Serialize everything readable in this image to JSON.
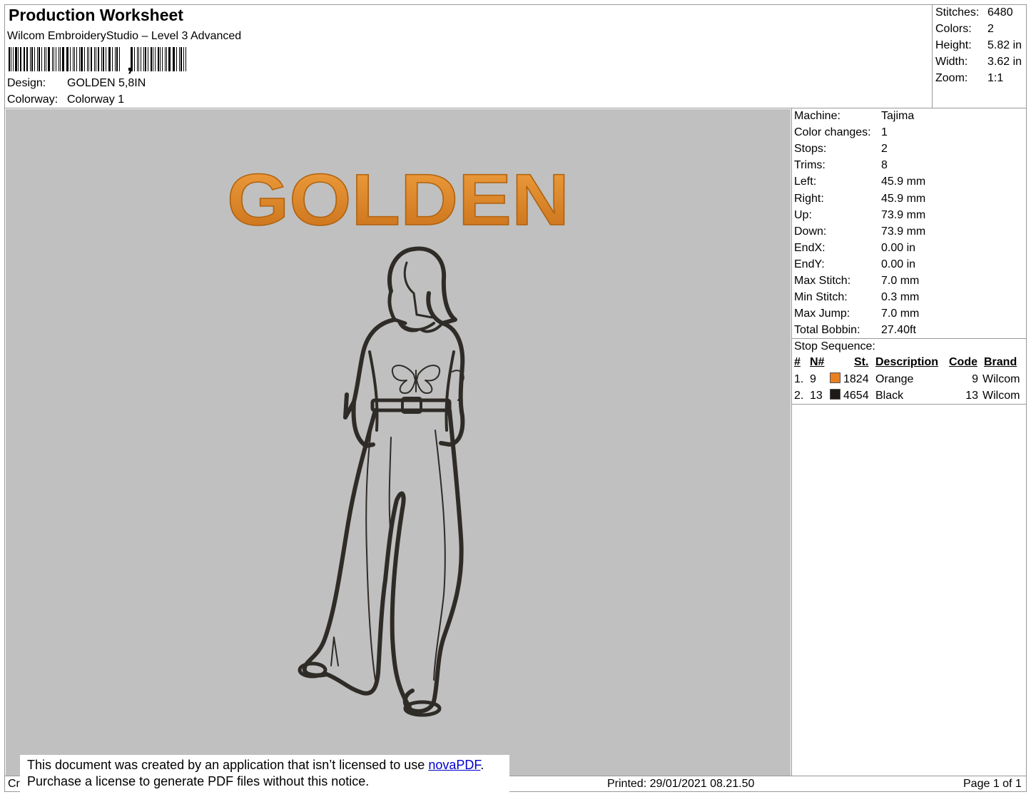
{
  "header": {
    "title": "Production Worksheet",
    "software": "Wilcom EmbroideryStudio – Level 3 Advanced",
    "barcode_char": ",",
    "design_label": "Design:",
    "design_value": "GOLDEN 5,8IN",
    "colorway_label": "Colorway:",
    "colorway_value": "Colorway 1"
  },
  "summary": [
    {
      "label": "Stitches:",
      "value": "6480"
    },
    {
      "label": "Colors:",
      "value": "2"
    },
    {
      "label": "Height:",
      "value": "5.82 in"
    },
    {
      "label": "Width:",
      "value": "3.62 in"
    },
    {
      "label": "Zoom:",
      "value": "1:1"
    }
  ],
  "machine_info": [
    {
      "label": "Machine:",
      "value": "Tajima"
    },
    {
      "label": "Color changes:",
      "value": "1"
    },
    {
      "label": "Stops:",
      "value": "2"
    },
    {
      "label": "Trims:",
      "value": "8"
    },
    {
      "label": "Left:",
      "value": "45.9 mm"
    },
    {
      "label": "Right:",
      "value": "45.9 mm"
    },
    {
      "label": "Up:",
      "value": "73.9 mm"
    },
    {
      "label": "Down:",
      "value": "73.9 mm"
    },
    {
      "label": "EndX:",
      "value": "0.00 in"
    },
    {
      "label": "EndY:",
      "value": "0.00 in"
    },
    {
      "label": "Max Stitch:",
      "value": "7.0 mm"
    },
    {
      "label": "Min Stitch:",
      "value": "0.3 mm"
    },
    {
      "label": "Max Jump:",
      "value": "7.0 mm"
    },
    {
      "label": "Total Bobbin:",
      "value": "27.40ft"
    }
  ],
  "stop_sequence": {
    "title": "Stop Sequence:",
    "headers": {
      "num": "#",
      "n": "N#",
      "st": "St.",
      "desc": "Description",
      "code": "Code",
      "brand": "Brand"
    },
    "rows": [
      {
        "num": "1.",
        "n": "9",
        "color": "#e8801f",
        "st": "1824",
        "desc": "Orange",
        "code": "9",
        "brand": "Wilcom"
      },
      {
        "num": "2.",
        "n": "13",
        "color": "#1e1a16",
        "st": "4654",
        "desc": "Black",
        "code": "13",
        "brand": "Wilcom"
      }
    ]
  },
  "design": {
    "text": "GOLDEN",
    "text_color": "#e0882a",
    "outline_color": "#2f2c28",
    "background": "#c0c0c0"
  },
  "footer": {
    "left_stub": "Cr",
    "notice_line1": "This document was created by an application that isn’t licensed to use ",
    "notice_link": "novaPDF",
    "notice_period": ".",
    "notice_line2": "Purchase a license to generate PDF files without this notice.",
    "printed": "Printed: 29/01/2021 08.21.50",
    "page": "Page 1 of 1"
  }
}
